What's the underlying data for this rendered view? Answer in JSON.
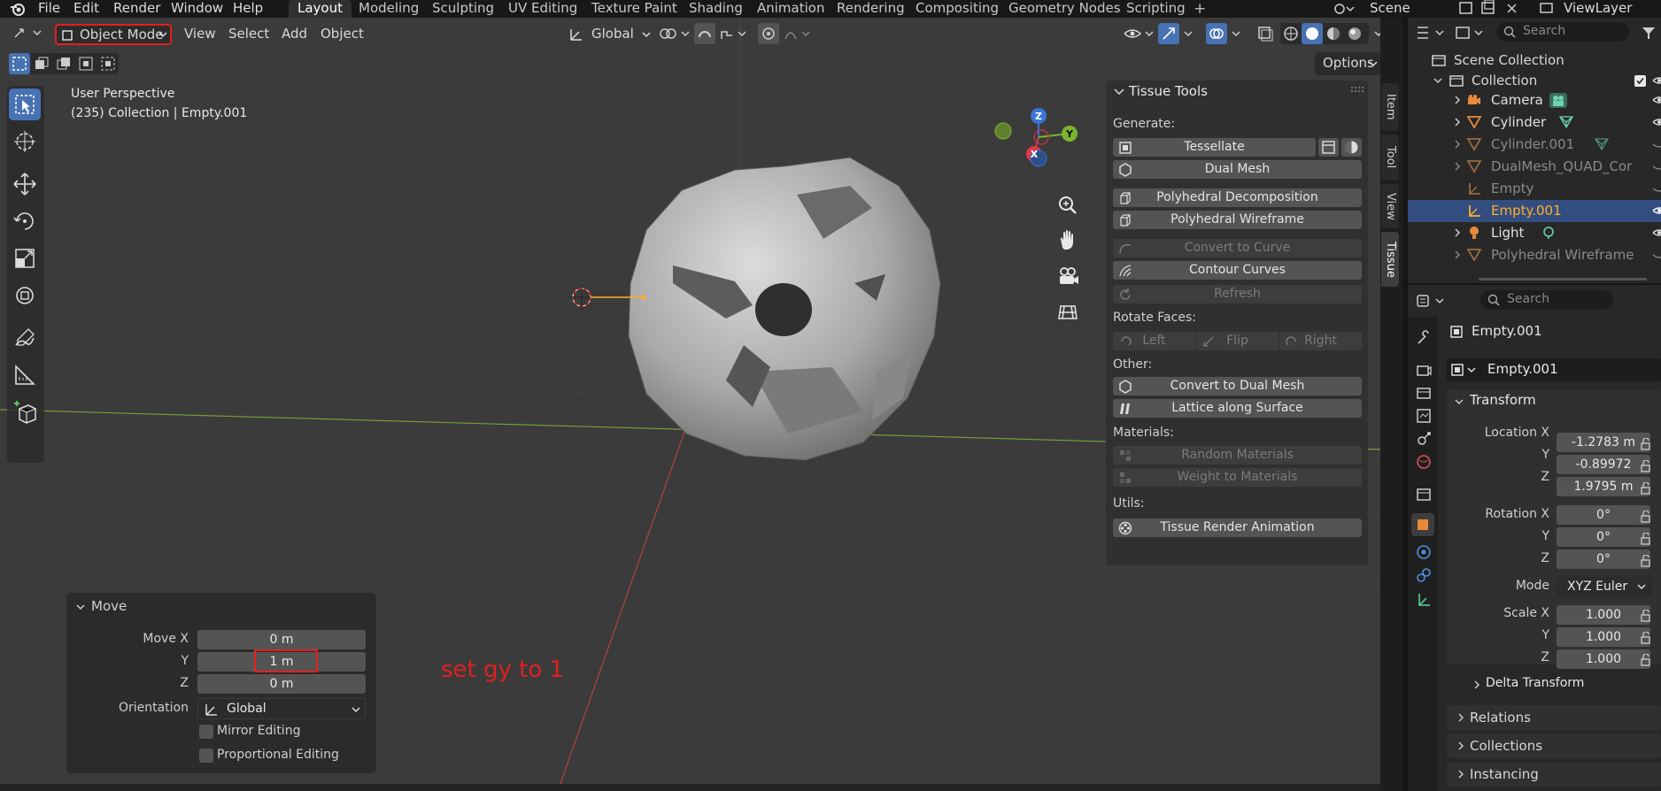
{
  "topbar": {
    "menus": [
      "File",
      "Edit",
      "Render",
      "Window",
      "Help"
    ],
    "workspace_tabs": [
      "Layout",
      "Modeling",
      "Sculpting",
      "UV Editing",
      "Texture Paint",
      "Shading",
      "Animation",
      "Rendering",
      "Compositing",
      "Geometry Nodes",
      "Scripting"
    ],
    "active_tab": "Layout",
    "add_tab": "+",
    "scene": "Scene",
    "view_layer": "ViewLayer"
  },
  "viewport_header": {
    "mode": "Object Mode",
    "menus": [
      "View",
      "Select",
      "Add",
      "Object"
    ],
    "orientation": "Global",
    "options": "Options"
  },
  "viewport": {
    "info_line1": "User Perspective",
    "info_line2": "(235) Collection | Empty.001",
    "annotation": "set gy to 1",
    "gizmo": {
      "z": "Z",
      "y": "Y",
      "x": "X"
    }
  },
  "tissue_panel": {
    "title": "Tissue Tools",
    "sections": {
      "generate": "Generate:",
      "rotate": "Rotate Faces:",
      "other": "Other:",
      "materials": "Materials:",
      "utils": "Utils:"
    },
    "buttons": {
      "tessellate": "Tessellate",
      "dual_mesh": "Dual Mesh",
      "polyhedral_decomposition": "Polyhedral Decomposition",
      "polyhedral_wireframe": "Polyhedral Wireframe",
      "convert_to_curve": "Convert to Curve",
      "contour_curves": "Contour Curves",
      "refresh": "Refresh",
      "left": "Left",
      "flip": "Flip",
      "right": "Right",
      "convert_to_dual_mesh": "Convert to Dual Mesh",
      "lattice_along_surface": "Lattice along Surface",
      "random_materials": "Random Materials",
      "weight_to_materials": "Weight to Materials",
      "tissue_render_animation": "Tissue Render Animation"
    }
  },
  "side_tabs": [
    "Item",
    "Tool",
    "View",
    "Tissue"
  ],
  "outliner": {
    "search_placeholder": "Search",
    "scene_collection": "Scene Collection",
    "collection": "Collection",
    "items": [
      "Camera",
      "Cylinder",
      "Cylinder.001",
      "DualMesh_QUAD_Cor",
      "Empty",
      "Empty.001",
      "Light",
      "Polyhedral Wireframe"
    ]
  },
  "properties": {
    "search_placeholder": "Search",
    "object_name": "Empty.001",
    "object_field": "Empty.001",
    "transform_title": "Transform",
    "location_label": "Location X",
    "rotation_label": "Rotation X",
    "scale_label": "Scale X",
    "y_label": "Y",
    "z_label": "Z",
    "location": [
      "-1.2783 m",
      "-0.89972",
      "1.9795 m"
    ],
    "rotation": [
      "0°",
      "0°",
      "0°"
    ],
    "mode_label": "Mode",
    "mode_value": "XYZ Euler",
    "scale": [
      "1.000",
      "1.000",
      "1.000"
    ],
    "delta_transform": "Delta Transform",
    "relations": "Relations",
    "collections": "Collections",
    "instancing": "Instancing"
  },
  "move_panel": {
    "title": "Move",
    "move_x_label": "Move X",
    "y_label": "Y",
    "z_label": "Z",
    "move_x": "0 m",
    "move_y": "1 m",
    "move_z": "0 m",
    "orientation_label": "Orientation",
    "orientation_value": "Global",
    "mirror_editing": "Mirror Editing",
    "proportional_editing": "Proportional Editing"
  },
  "colors": {
    "accent": "#4772b3",
    "annotation_red": "#e02020",
    "selected_orange": "#ffaf29"
  }
}
